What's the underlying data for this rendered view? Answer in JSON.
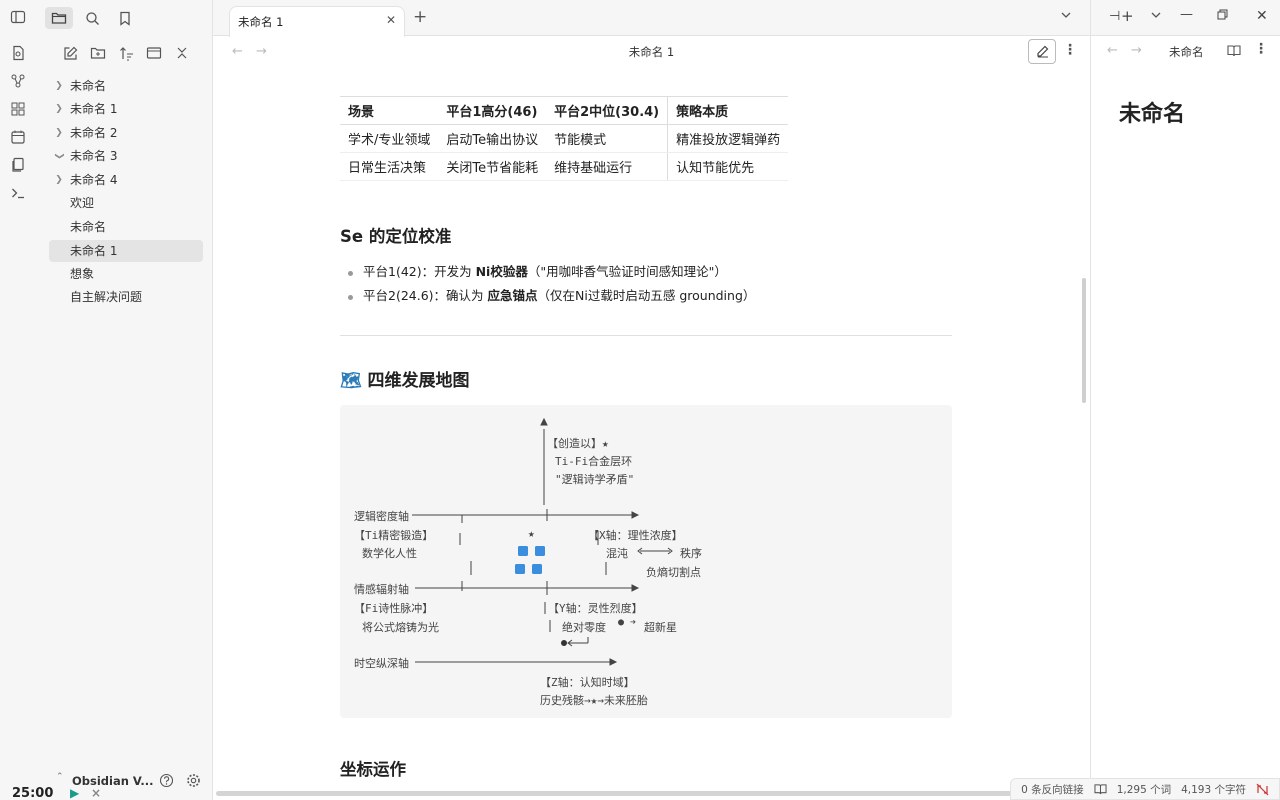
{
  "sidebar": {
    "items": [
      {
        "label": "未命名",
        "chevron": "right"
      },
      {
        "label": "未命名 1",
        "chevron": "right"
      },
      {
        "label": "未命名 2",
        "chevron": "right"
      },
      {
        "label": "未命名 3",
        "chevron": "down"
      },
      {
        "label": "未命名 4",
        "chevron": "right"
      },
      {
        "label": "欢迎",
        "chevron": ""
      },
      {
        "label": "未命名",
        "chevron": ""
      },
      {
        "label": "未命名 1",
        "chevron": "",
        "selected": true
      },
      {
        "label": "想象",
        "chevron": ""
      },
      {
        "label": "自主解决问题",
        "chevron": ""
      }
    ],
    "vault_name": "Obsidian V..."
  },
  "tabs": {
    "active_label": "未命名 1"
  },
  "editor": {
    "title": "未命名 1",
    "table": {
      "headers": [
        "场景",
        "平台1高分(46)",
        "平台2中位(30.4)",
        "策略本质"
      ],
      "rows": [
        [
          "学术/专业领域",
          "启动Te输出协议",
          "节能模式",
          "精准投放逻辑弹药"
        ],
        [
          "日常生活决策",
          "关闭Te节省能耗",
          "维持基础运行",
          "认知节能优先"
        ]
      ]
    },
    "section1": {
      "title": "Se 的定位校准",
      "bullets": [
        {
          "prefix": "平台1(42)：开发为 ",
          "bold": "Ni校验器",
          "suffix": "（\"用咖啡香气验证时间感知理论\"）"
        },
        {
          "prefix": "平台2(24.6)：确认为 ",
          "bold": "应急锚点",
          "suffix": "（仅在Ni过载时启动五感 grounding）"
        }
      ]
    },
    "section2": {
      "emoji": "🗺",
      "title": "四维发展地图"
    },
    "diagram": {
      "creator": "【创造以】★",
      "ti_fi": "Ti-Fi合金层环",
      "quote": "\"逻辑诗学矛盾\"",
      "axis1": "逻辑密度轴",
      "ti_label": "【Ti精密锻造】",
      "ti_sub": "数学化人性",
      "star": "★",
      "x_axis": "【X轴：理性浓度】",
      "x_chaos": "混沌",
      "x_order": "秩序",
      "x_cut": "负熵切割点",
      "axis2": "情感辐射轴",
      "fi_label": "【Fi诗性脉冲】",
      "fi_sub": "将公式熔铸为光",
      "y_axis": "【Y轴：灵性烈度】",
      "y_zero": "绝对零度",
      "y_nova": "超新星",
      "axis3": "时空纵深轴",
      "z_axis": "【Z轴：认知时域】",
      "z_line": "历史残骸→★→未来胚胎"
    },
    "section3": {
      "title": "坐标运作"
    }
  },
  "right_panel": {
    "tab_label": "未命名",
    "title": "未命名"
  },
  "status": {
    "backlinks": "0 条反向链接",
    "words": "1,295 个词",
    "chars": "4,193 个字符"
  },
  "pomodoro": {
    "time": "25:00"
  }
}
